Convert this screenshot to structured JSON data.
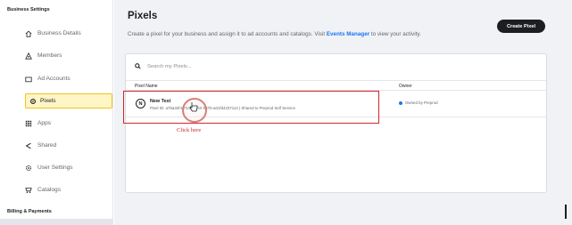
{
  "sidebar": {
    "business_heading": "Business Settings",
    "billing_heading": "Billing & Payments",
    "items": [
      {
        "label": "Business Details",
        "icon": "home-icon"
      },
      {
        "label": "Members",
        "icon": "members-icon"
      },
      {
        "label": "Ad Accounts",
        "icon": "folder-icon"
      },
      {
        "label": "Pixels",
        "icon": "pixel-icon",
        "active": true
      },
      {
        "label": "Apps",
        "icon": "apps-grid-icon"
      },
      {
        "label": "Shared",
        "icon": "share-icon"
      },
      {
        "label": "User Settings",
        "icon": "gear-icon"
      },
      {
        "label": "Catalogs",
        "icon": "catalog-icon"
      }
    ]
  },
  "header": {
    "title": "Pixels",
    "subtitle_before": "Create a pixel for your business and assign it to ad accounts and catalogs. Visit ",
    "subtitle_link": "Events Manager",
    "subtitle_after": " to view your activity.",
    "create_button": "Create Pixel"
  },
  "search": {
    "placeholder": "Search my Pixels..."
  },
  "table": {
    "columns": [
      "Pixel Name",
      "Owner"
    ],
    "rows": [
      {
        "avatar": "N",
        "name": "New Test",
        "meta": "Pixel ID: a7ba32f4-70a5-4359-b47b-a01fd4237112 | Shared to Preprod Self Service",
        "owner": "Owned by Preprod"
      }
    ]
  },
  "annotation": {
    "label": "Click here"
  },
  "colors": {
    "accent": "#1877f2",
    "annotation": "#d3242b",
    "active_bg": "#fff6c7",
    "active_border": "#f0c419",
    "primary_button": "#1c1e21"
  }
}
